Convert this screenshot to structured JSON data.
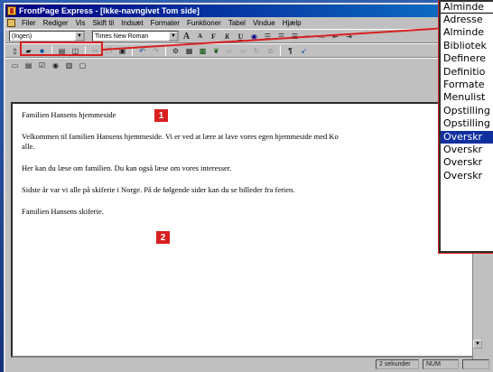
{
  "window": {
    "title": "FrontPage Express - [Ikke-navngivet Tom side]"
  },
  "menu": [
    "Filer",
    "Rediger",
    "Vis",
    "Skift til",
    "Indsæt",
    "Formater",
    "Funktioner",
    "Tabel",
    "Vindue",
    "Hjælp"
  ],
  "format_toolbar": {
    "style_value": "(Ingen)",
    "font_value": "Times New Roman"
  },
  "document": {
    "lines": [
      "Familien Hansens hjemmeside",
      "Velkommen til familien Hansens hjemmeside. Vi er ved at lære at lave vores egen hjemmeside med Ko",
      "alle.",
      "Her kan du læse om familien. Du kan også læse om vores interesser.",
      "Sidste år var vi alle på skiferie i Norge. På de følgende sider kan du se billeder fra ferien.",
      "Familien Hansens skiferie."
    ],
    "markers": [
      "1",
      "2"
    ]
  },
  "statusbar": {
    "load_time": "2 sekunder",
    "numlock": "NUM"
  },
  "style_dropdown": {
    "current": "Alminde",
    "items": [
      "Adresse",
      "Alminde",
      "Bibliotek",
      "Definere",
      "Definitio",
      "Formate",
      "Menulist",
      "Opstilling",
      "Opstilling",
      "Overskr",
      "Overskr",
      "Overskr",
      "Overskr"
    ],
    "highlighted_index": 9
  },
  "colors": {
    "accent_red": "#d82020",
    "title_blue": "#000080",
    "selection_blue": "#1030a0"
  }
}
